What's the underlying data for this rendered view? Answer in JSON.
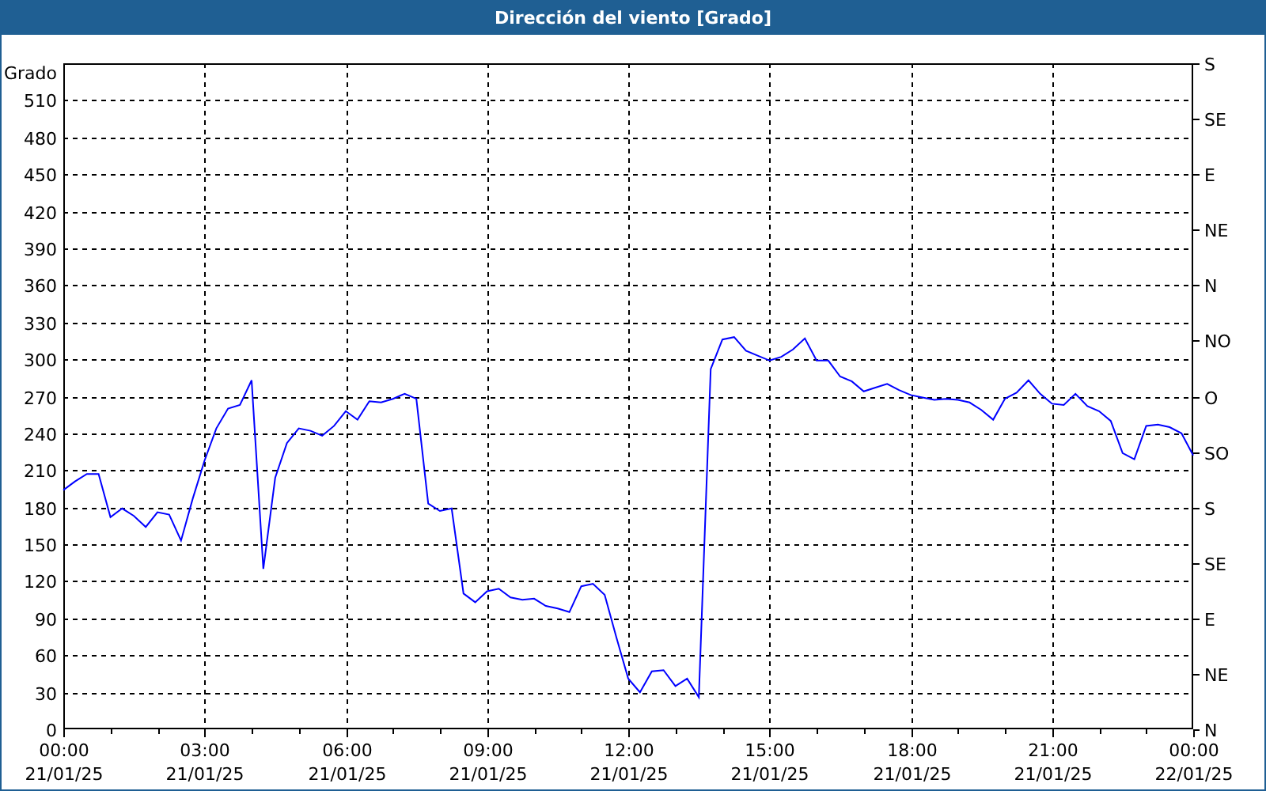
{
  "window": {
    "title": "Dirección del viento [Grado]"
  },
  "chart": {
    "chart_data": {
      "type": "line",
      "grid": true,
      "ylabel": "Grado",
      "ylim": [
        0,
        540
      ],
      "yticks": [
        0,
        30,
        60,
        90,
        120,
        150,
        180,
        210,
        240,
        270,
        300,
        330,
        360,
        390,
        420,
        450,
        480,
        510
      ],
      "categories": [
        "00:00\n21/01/25",
        null,
        null,
        null,
        null,
        null,
        null,
        null,
        null,
        null,
        null,
        null,
        "03:00\n21/01/25",
        null,
        null,
        null,
        null,
        null,
        null,
        null,
        null,
        null,
        null,
        null,
        "06:00\n21/01/25",
        null,
        null,
        null,
        null,
        null,
        null,
        null,
        null,
        null,
        null,
        null,
        "09:00\n21/01/25",
        null,
        null,
        null,
        null,
        null,
        null,
        null,
        null,
        null,
        null,
        null,
        "12:00\n21/01/25",
        null,
        null,
        null,
        null,
        null,
        null,
        null,
        null,
        null,
        null,
        null,
        "15:00\n21/01/25",
        null,
        null,
        null,
        null,
        null,
        null,
        null,
        null,
        null,
        null,
        null,
        "18:00\n21/01/25",
        null,
        null,
        null,
        null,
        null,
        null,
        null,
        null,
        null,
        null,
        null,
        "21:00\n21/01/25",
        null,
        null,
        null,
        null,
        null,
        null,
        null,
        null,
        null,
        null,
        null,
        "00:00\n22/01/25"
      ],
      "series": [
        {
          "color": "#0000ff",
          "values": [
            194,
            201,
            207,
            207,
            172,
            179,
            173,
            164,
            176,
            174,
            153,
            187,
            218,
            244,
            260,
            263,
            283,
            130,
            204,
            232,
            244,
            242,
            238,
            246,
            258,
            251,
            266,
            265,
            268,
            272,
            268,
            183,
            177,
            179,
            110,
            103,
            112,
            114,
            107,
            105,
            106,
            100,
            98,
            95,
            116,
            118,
            109,
            74,
            41,
            30,
            47,
            48,
            35,
            41,
            26,
            292,
            316,
            318,
            307,
            303,
            299,
            302,
            308,
            317,
            299,
            299,
            286,
            282,
            274,
            277,
            280,
            275,
            271,
            269,
            267,
            268,
            267,
            265,
            259,
            251,
            268,
            273,
            283,
            272,
            264,
            263,
            272,
            262,
            258,
            250,
            224,
            219,
            246,
            247,
            245,
            240,
            222
          ]
        }
      ]
    },
    "right_axis": {
      "labels": [
        "S",
        "SE",
        "E",
        "NE",
        "N",
        "NO",
        "O",
        "SO",
        "S",
        "SE",
        "E",
        "NE",
        "N"
      ]
    }
  }
}
